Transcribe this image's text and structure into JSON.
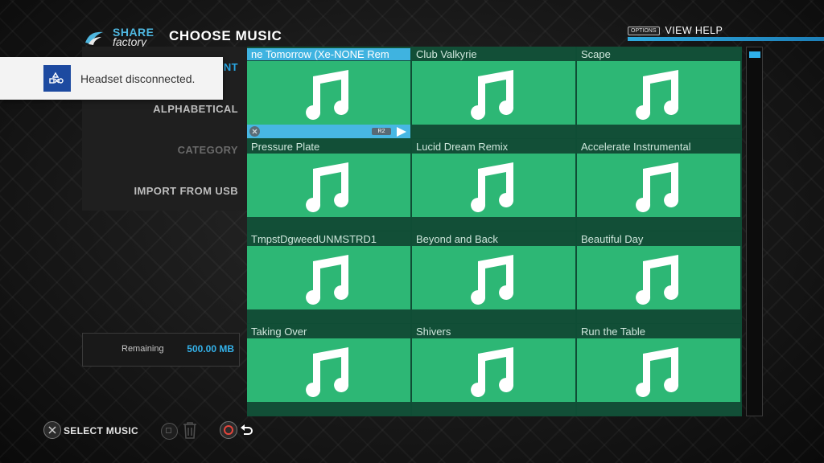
{
  "app": {
    "logo_share": "SHARE",
    "logo_factory": "factory",
    "title": "CHOOSE MUSIC",
    "help_badge": "OPTIONS",
    "help_label": "VIEW HELP"
  },
  "sidebar": {
    "items": [
      {
        "label": "NT"
      },
      {
        "label": "ALPHABETICAL"
      },
      {
        "label": "CATEGORY"
      },
      {
        "label": "IMPORT FROM USB"
      }
    ]
  },
  "storage": {
    "label": "Remaining",
    "value": "500.00 MB"
  },
  "toast": {
    "message": "Headset disconnected."
  },
  "tracks": [
    {
      "title": "ne Tomorrow (Xe-NONE Rem",
      "selected": true
    },
    {
      "title": "Club Valkyrie"
    },
    {
      "title": "Scape"
    },
    {
      "title": "Pressure Plate"
    },
    {
      "title": "Lucid Dream Remix"
    },
    {
      "title": "Accelerate Instrumental"
    },
    {
      "title": "TmpstDgweedUNMSTRD1"
    },
    {
      "title": "Beyond and Back"
    },
    {
      "title": "Beautiful Day"
    },
    {
      "title": "Taking Over"
    },
    {
      "title": "Shivers"
    },
    {
      "title": "Run the Table"
    }
  ],
  "selected_bar": {
    "r2_label": "R2"
  },
  "footer": {
    "select_label": "SELECT MUSIC"
  },
  "icons": {
    "track_art": "music-note-icon",
    "toast": "playstation-buttons-icon",
    "delete": "trash-icon",
    "back": "back-arrow-icon"
  },
  "colors": {
    "accent": "#29a6e2",
    "tile_green": "#2db775",
    "grid_bg": "#0f4d35"
  }
}
